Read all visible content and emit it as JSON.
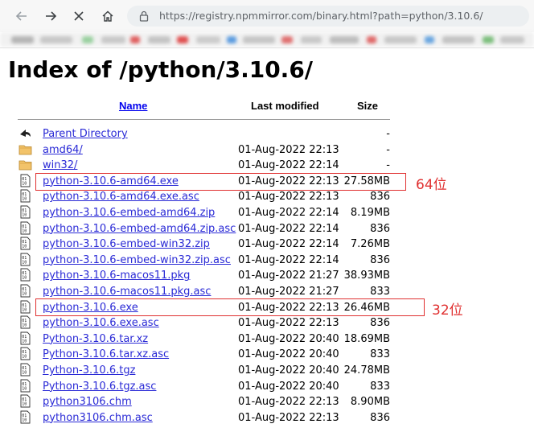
{
  "browser": {
    "url": "https://registry.npmmirror.com/binary.html?path=python/3.10.6/"
  },
  "page": {
    "title": "Index of /python/3.10.6/",
    "columns": {
      "name": "Name",
      "modified": "Last modified",
      "size": "Size"
    }
  },
  "entries": [
    {
      "name": "Parent Directory",
      "date": "",
      "size": "-",
      "icon": "back-icon"
    },
    {
      "name": "amd64/",
      "date": "01-Aug-2022 22:13",
      "size": "-",
      "icon": "folder-icon"
    },
    {
      "name": "win32/",
      "date": "01-Aug-2022 22:14",
      "size": "-",
      "icon": "folder-icon"
    },
    {
      "name": "python-3.10.6-amd64.exe",
      "date": "01-Aug-2022 22:13",
      "size": "27.58MB",
      "icon": "binary-file-icon"
    },
    {
      "name": "python-3.10.6-amd64.exe.asc",
      "date": "01-Aug-2022 22:13",
      "size": "836",
      "icon": "binary-file-icon"
    },
    {
      "name": "python-3.10.6-embed-amd64.zip",
      "date": "01-Aug-2022 22:14",
      "size": "8.19MB",
      "icon": "binary-file-icon"
    },
    {
      "name": "python-3.10.6-embed-amd64.zip.asc",
      "date": "01-Aug-2022 22:14",
      "size": "836",
      "icon": "binary-file-icon"
    },
    {
      "name": "python-3.10.6-embed-win32.zip",
      "date": "01-Aug-2022 22:14",
      "size": "7.26MB",
      "icon": "binary-file-icon"
    },
    {
      "name": "python-3.10.6-embed-win32.zip.asc",
      "date": "01-Aug-2022 22:14",
      "size": "836",
      "icon": "binary-file-icon"
    },
    {
      "name": "python-3.10.6-macos11.pkg",
      "date": "01-Aug-2022 21:27",
      "size": "38.93MB",
      "icon": "binary-file-icon"
    },
    {
      "name": "python-3.10.6-macos11.pkg.asc",
      "date": "01-Aug-2022 21:27",
      "size": "833",
      "icon": "binary-file-icon"
    },
    {
      "name": "python-3.10.6.exe",
      "date": "01-Aug-2022 22:13",
      "size": "26.46MB",
      "icon": "binary-file-icon"
    },
    {
      "name": "python-3.10.6.exe.asc",
      "date": "01-Aug-2022 22:13",
      "size": "836",
      "icon": "binary-file-icon"
    },
    {
      "name": "Python-3.10.6.tar.xz",
      "date": "01-Aug-2022 20:40",
      "size": "18.69MB",
      "icon": "binary-file-icon"
    },
    {
      "name": "Python-3.10.6.tar.xz.asc",
      "date": "01-Aug-2022 20:40",
      "size": "833",
      "icon": "binary-file-icon"
    },
    {
      "name": "Python-3.10.6.tgz",
      "date": "01-Aug-2022 20:40",
      "size": "24.78MB",
      "icon": "binary-file-icon"
    },
    {
      "name": "Python-3.10.6.tgz.asc",
      "date": "01-Aug-2022 20:40",
      "size": "833",
      "icon": "binary-file-icon"
    },
    {
      "name": "python3106.chm",
      "date": "01-Aug-2022 22:13",
      "size": "8.90MB",
      "icon": "binary-file-icon"
    },
    {
      "name": "python3106.chm.asc",
      "date": "01-Aug-2022 22:13",
      "size": "836",
      "icon": "binary-file-icon"
    }
  ],
  "annotations": [
    {
      "label": "64位",
      "entry_index": 3
    },
    {
      "label": "32位",
      "entry_index": 11
    }
  ],
  "colors": {
    "link": "#2a2ad6",
    "highlight": "#e03030"
  }
}
